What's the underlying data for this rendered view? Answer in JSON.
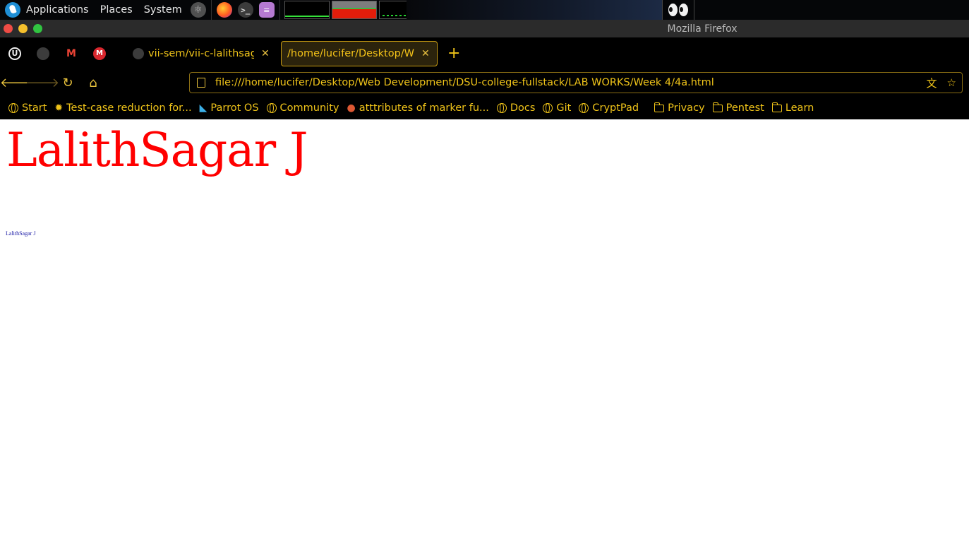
{
  "panel": {
    "menus": [
      "Applications",
      "Places",
      "System"
    ],
    "launchers": [
      "atom-icon",
      "firefox-icon",
      "terminal-icon",
      "text-editor-icon"
    ]
  },
  "window": {
    "title": "Mozilla Firefox"
  },
  "tabs": {
    "pinned": [
      "firefox-account-icon",
      "github-icon",
      "gmail-icon",
      "mega-icon"
    ],
    "items": [
      {
        "label": "vii-sem/vii-c-lalithsagarJ",
        "active": false
      },
      {
        "label": "/home/lucifer/Desktop/Web",
        "active": true
      }
    ],
    "new_tab": "+"
  },
  "nav": {
    "url": "file:///home/lucifer/Desktop/Web Development/DSU-college-fullstack/LAB WORKS/Week 4/4a.html"
  },
  "bookmarks": [
    {
      "label": "Start",
      "icon": "globe-icon"
    },
    {
      "label": "Test-case reduction for...",
      "icon": "gear-icon"
    },
    {
      "label": "Parrot OS",
      "icon": "parrot-icon"
    },
    {
      "label": "Community",
      "icon": "globe-icon"
    },
    {
      "label": "atttributes of marker fu...",
      "icon": "duckduckgo-icon"
    },
    {
      "label": "Docs",
      "icon": "globe-icon"
    },
    {
      "label": "Git",
      "icon": "globe-icon"
    },
    {
      "label": "CryptPad",
      "icon": "globe-icon"
    },
    {
      "label": "Privacy",
      "icon": "folder-icon"
    },
    {
      "label": "Pentest",
      "icon": "folder-icon"
    },
    {
      "label": "Learn",
      "icon": "folder-icon"
    }
  ],
  "page": {
    "heading": "LalithSagar J",
    "small_text": "LalithSagar J",
    "heading_color": "#ff0000",
    "small_text_color": "#1a1aa6"
  }
}
